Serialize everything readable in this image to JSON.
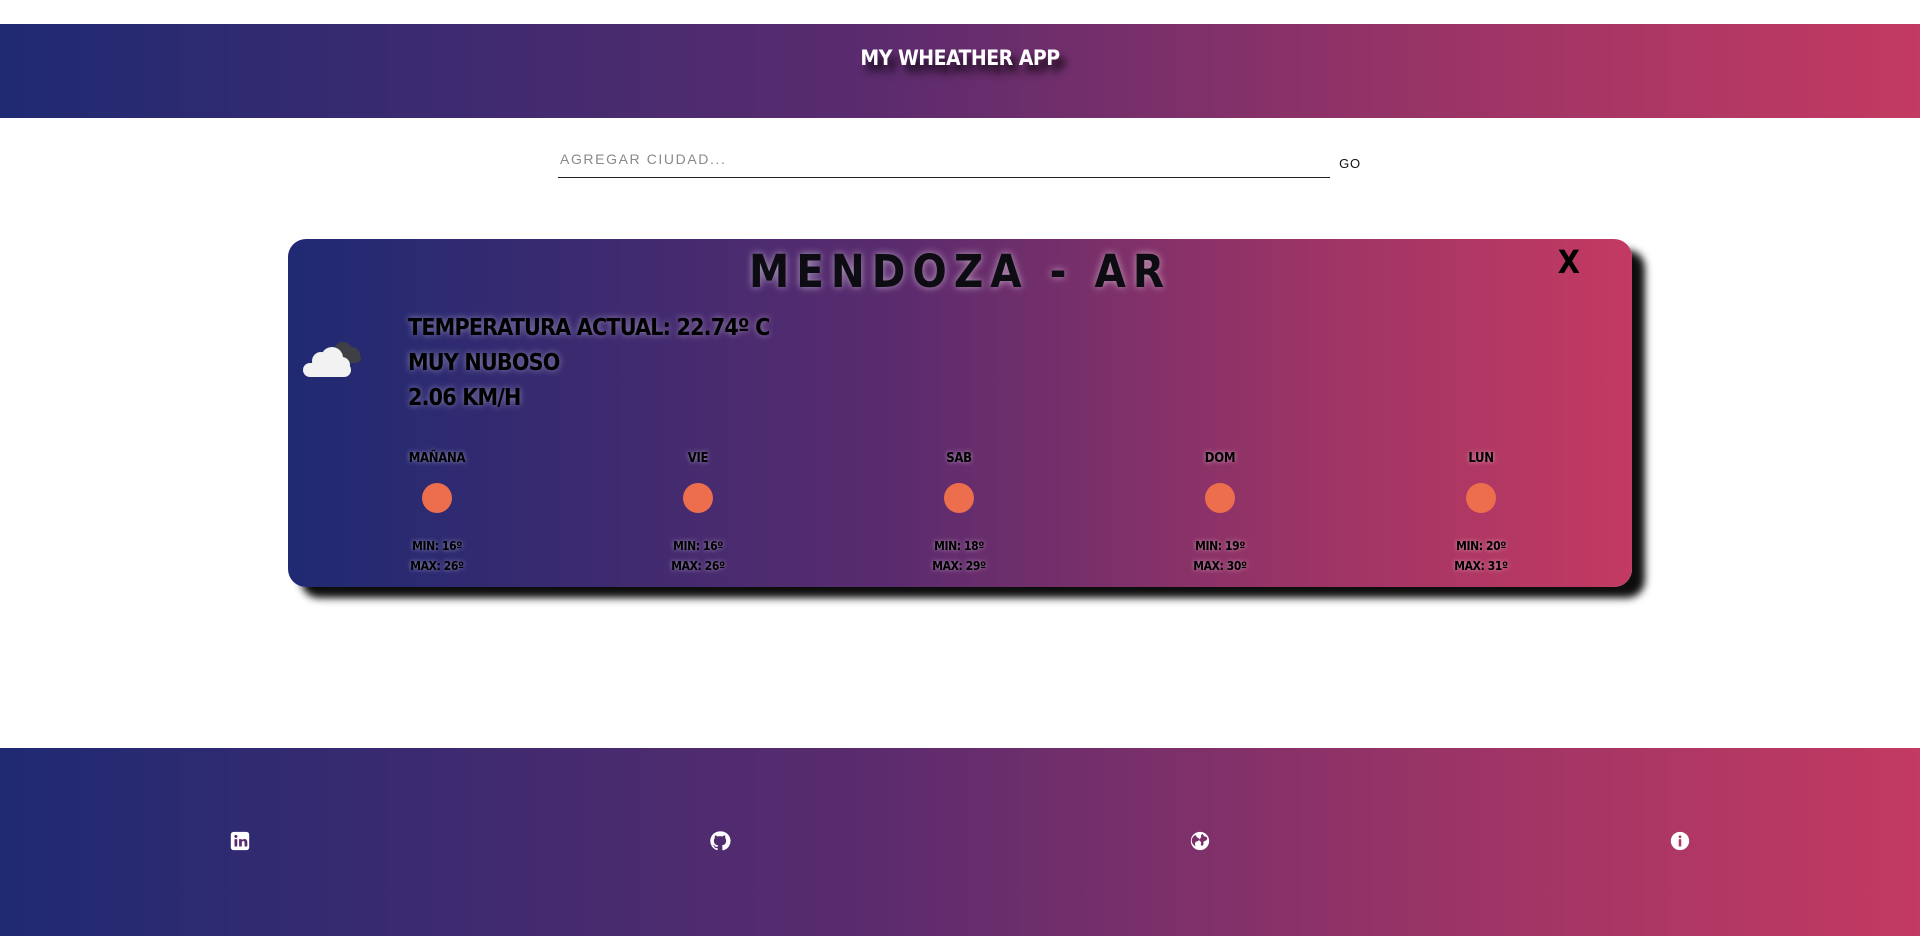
{
  "header": {
    "title": "MY WHEATHER APP"
  },
  "search": {
    "placeholder": "AGREGAR CIUDAD...",
    "value": "",
    "go_label": "GO"
  },
  "card": {
    "city": "MENDOZA - AR",
    "close_label": "X",
    "current_icon": "cloud-icon",
    "temperature": "TEMPERATURA ACTUAL: 22.74º C",
    "description": "MUY NUBOSO",
    "wind": "2.06 KM/H",
    "forecast": [
      {
        "day": "MAÑANA",
        "icon": "sun-icon",
        "min": "MIN: 16º",
        "max": "MAX: 26º"
      },
      {
        "day": "VIE",
        "icon": "sun-icon",
        "min": "MIN: 16º",
        "max": "MAX: 26º"
      },
      {
        "day": "SAB",
        "icon": "sun-icon",
        "min": "MIN: 18º",
        "max": "MAX: 29º"
      },
      {
        "day": "DOM",
        "icon": "sun-icon",
        "min": "MIN: 19º",
        "max": "MAX: 30º"
      },
      {
        "day": "LUN",
        "icon": "sun-icon",
        "min": "MIN: 20º",
        "max": "MAX: 31º"
      }
    ]
  },
  "footer": {
    "links": [
      {
        "icon": "linkedin-icon"
      },
      {
        "icon": "github-icon"
      },
      {
        "icon": "globe-icon"
      },
      {
        "icon": "info-icon"
      }
    ]
  },
  "colors": {
    "gradient_start": "#1f2a72",
    "gradient_end": "#c33a62",
    "sun": "#ec6e4c"
  }
}
